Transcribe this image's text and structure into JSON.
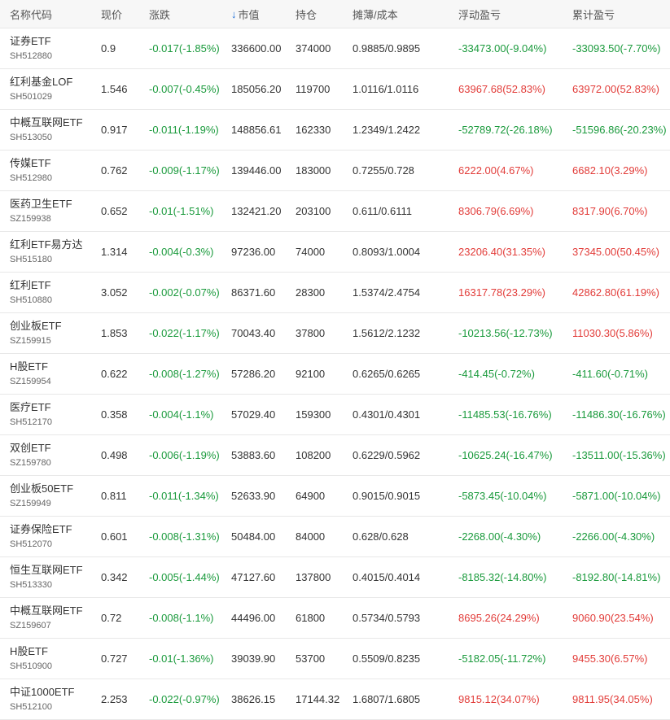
{
  "header": {
    "name_code": "名称代码",
    "price": "现价",
    "change": "涨跌",
    "market_value": "市值",
    "position": "持仓",
    "cost": "摊薄/成本",
    "float_pnl": "浮动盈亏",
    "cum_pnl": "累计盈亏",
    "sort_icon": "arrow-down-icon"
  },
  "colors": {
    "up": "#e23c39",
    "down": "#1a9a3c",
    "sort": "#1e6fd9"
  },
  "rows": [
    {
      "name": "证券ETF",
      "code": "SH512880",
      "price": "0.9",
      "change": "-0.017(-1.85%)",
      "mv": "336600.00",
      "pos": "374000",
      "cost": "0.9885/0.9895",
      "float": "-33473.00(-9.04%)",
      "cum": "-33093.50(-7.70%)"
    },
    {
      "name": "红利基金LOF",
      "code": "SH501029",
      "price": "1.546",
      "change": "-0.007(-0.45%)",
      "mv": "185056.20",
      "pos": "119700",
      "cost": "1.0116/1.0116",
      "float": "63967.68(52.83%)",
      "cum": "63972.00(52.83%)"
    },
    {
      "name": "中概互联网ETF",
      "code": "SH513050",
      "price": "0.917",
      "change": "-0.011(-1.19%)",
      "mv": "148856.61",
      "pos": "162330",
      "cost": "1.2349/1.2422",
      "float": "-52789.72(-26.18%)",
      "cum": "-51596.86(-20.23%)"
    },
    {
      "name": "传媒ETF",
      "code": "SH512980",
      "price": "0.762",
      "change": "-0.009(-1.17%)",
      "mv": "139446.00",
      "pos": "183000",
      "cost": "0.7255/0.728",
      "float": "6222.00(4.67%)",
      "cum": "6682.10(3.29%)"
    },
    {
      "name": "医药卫生ETF",
      "code": "SZ159938",
      "price": "0.652",
      "change": "-0.01(-1.51%)",
      "mv": "132421.20",
      "pos": "203100",
      "cost": "0.611/0.6111",
      "float": "8306.79(6.69%)",
      "cum": "8317.90(6.70%)"
    },
    {
      "name": "红利ETF易方达",
      "code": "SH515180",
      "price": "1.314",
      "change": "-0.004(-0.3%)",
      "mv": "97236.00",
      "pos": "74000",
      "cost": "0.8093/1.0004",
      "float": "23206.40(31.35%)",
      "cum": "37345.00(50.45%)"
    },
    {
      "name": "红利ETF",
      "code": "SH510880",
      "price": "3.052",
      "change": "-0.002(-0.07%)",
      "mv": "86371.60",
      "pos": "28300",
      "cost": "1.5374/2.4754",
      "float": "16317.78(23.29%)",
      "cum": "42862.80(61.19%)"
    },
    {
      "name": "创业板ETF",
      "code": "SZ159915",
      "price": "1.853",
      "change": "-0.022(-1.17%)",
      "mv": "70043.40",
      "pos": "37800",
      "cost": "1.5612/2.1232",
      "float": "-10213.56(-12.73%)",
      "cum": "11030.30(5.86%)"
    },
    {
      "name": "H股ETF",
      "code": "SZ159954",
      "price": "0.622",
      "change": "-0.008(-1.27%)",
      "mv": "57286.20",
      "pos": "92100",
      "cost": "0.6265/0.6265",
      "float": "-414.45(-0.72%)",
      "cum": "-411.60(-0.71%)"
    },
    {
      "name": "医疗ETF",
      "code": "SH512170",
      "price": "0.358",
      "change": "-0.004(-1.1%)",
      "mv": "57029.40",
      "pos": "159300",
      "cost": "0.4301/0.4301",
      "float": "-11485.53(-16.76%)",
      "cum": "-11486.30(-16.76%)"
    },
    {
      "name": "双创ETF",
      "code": "SZ159780",
      "price": "0.498",
      "change": "-0.006(-1.19%)",
      "mv": "53883.60",
      "pos": "108200",
      "cost": "0.6229/0.5962",
      "float": "-10625.24(-16.47%)",
      "cum": "-13511.00(-15.36%)"
    },
    {
      "name": "创业板50ETF",
      "code": "SZ159949",
      "price": "0.811",
      "change": "-0.011(-1.34%)",
      "mv": "52633.90",
      "pos": "64900",
      "cost": "0.9015/0.9015",
      "float": "-5873.45(-10.04%)",
      "cum": "-5871.00(-10.04%)"
    },
    {
      "name": "证券保险ETF",
      "code": "SH512070",
      "price": "0.601",
      "change": "-0.008(-1.31%)",
      "mv": "50484.00",
      "pos": "84000",
      "cost": "0.628/0.628",
      "float": "-2268.00(-4.30%)",
      "cum": "-2266.00(-4.30%)"
    },
    {
      "name": "恒生互联网ETF",
      "code": "SH513330",
      "price": "0.342",
      "change": "-0.005(-1.44%)",
      "mv": "47127.60",
      "pos": "137800",
      "cost": "0.4015/0.4014",
      "float": "-8185.32(-14.80%)",
      "cum": "-8192.80(-14.81%)"
    },
    {
      "name": "中概互联网ETF",
      "code": "SZ159607",
      "price": "0.72",
      "change": "-0.008(-1.1%)",
      "mv": "44496.00",
      "pos": "61800",
      "cost": "0.5734/0.5793",
      "float": "8695.26(24.29%)",
      "cum": "9060.90(23.54%)"
    },
    {
      "name": "H股ETF",
      "code": "SH510900",
      "price": "0.727",
      "change": "-0.01(-1.36%)",
      "mv": "39039.90",
      "pos": "53700",
      "cost": "0.5509/0.8235",
      "float": "-5182.05(-11.72%)",
      "cum": "9455.30(6.57%)"
    },
    {
      "name": "中证1000ETF",
      "code": "SH512100",
      "price": "2.253",
      "change": "-0.022(-0.97%)",
      "mv": "38626.15",
      "pos": "17144.32",
      "cost": "1.6807/1.6805",
      "float": "9815.12(34.07%)",
      "cum": "9811.95(34.05%)"
    }
  ]
}
